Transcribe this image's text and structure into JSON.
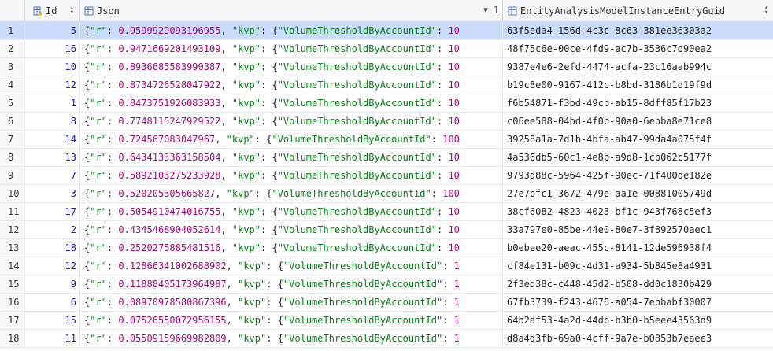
{
  "header": {
    "id_label": "Id",
    "json_label": "Json",
    "json_sort_order": "1",
    "guid_label": "EntityAnalysisModelInstanceEntryGuid"
  },
  "colors": {
    "selected_row": "#c9dcfb",
    "string_key": "#067d17",
    "number": "#a5087a",
    "id_number": "#1a1aa6"
  },
  "icons": [
    "key-column-icon",
    "table-column-icon",
    "sort-updown-icon",
    "sort-down-icon"
  ],
  "rows": [
    {
      "rownum": "1",
      "id": "5",
      "r": "0.9599929093196955",
      "kvp_val": "10",
      "guid": "63f5eda4-156d-4c3c-8c63-381ee36303a2",
      "selected": true
    },
    {
      "rownum": "2",
      "id": "16",
      "r": "0.9471669201493109",
      "kvp_val": "10",
      "guid": "48f75c6e-00ce-4fd9-ac7b-3536c7d90ea2"
    },
    {
      "rownum": "3",
      "id": "10",
      "r": "0.8936685583990387",
      "kvp_val": "10",
      "guid": "9387e4e6-2efd-4474-acfa-23c16aab994c"
    },
    {
      "rownum": "4",
      "id": "12",
      "r": "0.8734726528047922",
      "kvp_val": "10",
      "guid": "b19c8e00-9167-412c-b8bd-3186b1d19f9d"
    },
    {
      "rownum": "5",
      "id": "1",
      "r": "0.8473751926083933",
      "kvp_val": "10",
      "guid": "f6b54871-f3bd-49cb-ab15-8dff85f17b23"
    },
    {
      "rownum": "6",
      "id": "8",
      "r": "0.7748115247929522",
      "kvp_val": "10",
      "guid": "c06ee588-04bd-4f0b-90a0-6ebba8e71ce8"
    },
    {
      "rownum": "7",
      "id": "14",
      "r": "0.724567083047967",
      "kvp_val": "100",
      "guid": "39258a1a-7d1b-4bfa-ab47-99da4a075f4f"
    },
    {
      "rownum": "8",
      "id": "13",
      "r": "0.6434133363158504",
      "kvp_val": "10",
      "guid": "4a536db5-60c1-4e8b-a9d8-1cb062c5177f"
    },
    {
      "rownum": "9",
      "id": "7",
      "r": "0.5892103275233928",
      "kvp_val": "10",
      "guid": "9793d88c-5964-425f-90ec-71f400de182e"
    },
    {
      "rownum": "10",
      "id": "3",
      "r": "0.520205305665827",
      "kvp_val": "100",
      "guid": "27e7bfc1-3672-479e-aa1e-00881005749d"
    },
    {
      "rownum": "11",
      "id": "17",
      "r": "0.5054910474016755",
      "kvp_val": "10",
      "guid": "38cf6082-4823-4023-bf1c-943f768c5ef3"
    },
    {
      "rownum": "12",
      "id": "2",
      "r": "0.4345468904052614",
      "kvp_val": "10",
      "guid": "33a797e0-85be-44e0-80e7-3f892570aec1"
    },
    {
      "rownum": "13",
      "id": "18",
      "r": "0.2520275885481516",
      "kvp_val": "10",
      "guid": "b0ebee20-aeac-455c-8141-12de596938f4"
    },
    {
      "rownum": "14",
      "id": "12",
      "r": "0.12866341002688902",
      "kvp_val": "1",
      "guid": "cf84e131-b09c-4d31-a934-5b845e8a4931"
    },
    {
      "rownum": "15",
      "id": "9",
      "r": "0.11888405173964987",
      "kvp_val": "1",
      "guid": "2f3ed38c-c448-45d2-b508-dd0c1830b429"
    },
    {
      "rownum": "16",
      "id": "6",
      "r": "0.08970978580867396",
      "kvp_val": "1",
      "guid": "67fb3739-f243-4676-a054-7ebbabf30007"
    },
    {
      "rownum": "17",
      "id": "15",
      "r": "0.07526550072956155",
      "kvp_val": "1",
      "guid": "64b2af53-4a2d-44db-b3b0-b5eee43563d9"
    },
    {
      "rownum": "18",
      "id": "11",
      "r": "0.05509159669982809",
      "kvp_val": "1",
      "guid": "d8a4d3fb-69a0-4cff-9a7e-b0853b7eaee3"
    }
  ],
  "json_tokens": {
    "open": "{",
    "r_key": "\"r\"",
    "colon": ": ",
    "comma": ", ",
    "kvp_key": "\"kvp\"",
    "inner_key": "\"VolumeThresholdByAccountId\""
  }
}
